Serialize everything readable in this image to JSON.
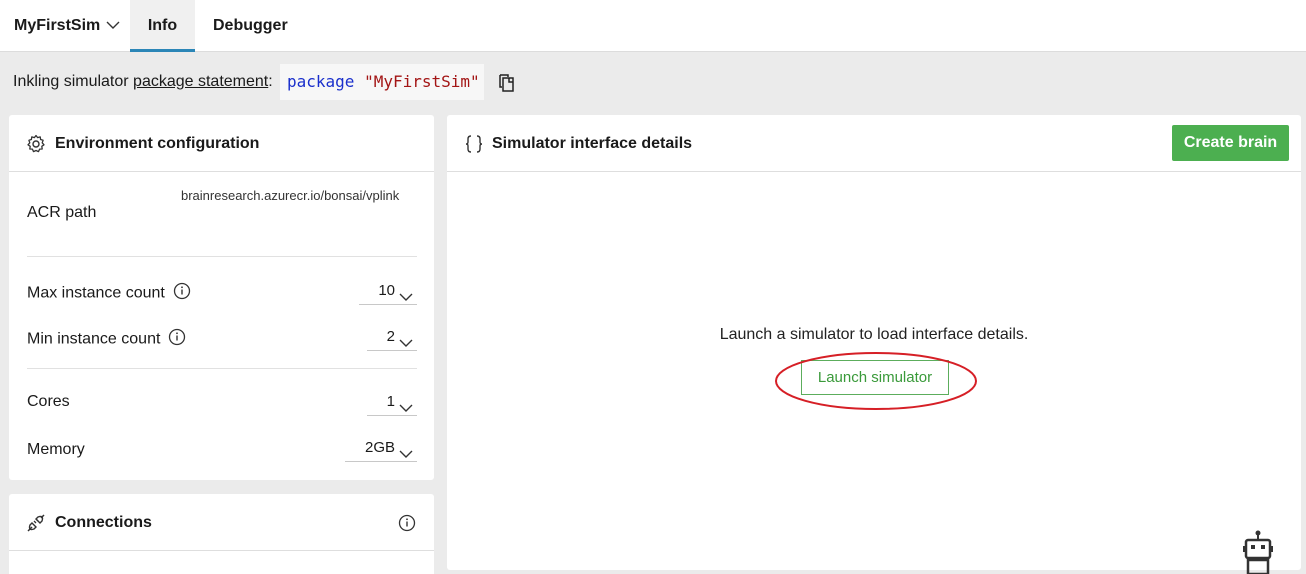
{
  "topbar": {
    "sim_name": "MyFirstSim",
    "tabs": [
      {
        "label": "Info",
        "active": true
      },
      {
        "label": "Debugger",
        "active": false
      }
    ]
  },
  "package_row": {
    "prefix": "Inkling simulator ",
    "link_text": "package statement",
    "suffix": ":",
    "code_keyword": "package",
    "code_string": "\"MyFirstSim\"",
    "copy_icon": "copy-icon"
  },
  "env_config": {
    "title": "Environment configuration",
    "icon": "gear-icon",
    "acr_label": "ACR path",
    "acr_value": "brainresearch.azurecr.io/bonsai/vplink",
    "max_instance_label": "Max instance count",
    "max_instance_value": "10",
    "min_instance_label": "Min instance count",
    "min_instance_value": "2",
    "cores_label": "Cores",
    "cores_value": "1",
    "memory_label": "Memory",
    "memory_value": "2GB"
  },
  "connections": {
    "title": "Connections",
    "icon": "plug-icon"
  },
  "sim_interface": {
    "title": "Simulator interface details",
    "icon": "braces-icon",
    "create_brain_label": "Create brain",
    "empty_message": "Launch a simulator to load interface details.",
    "launch_label": "Launch simulator"
  },
  "colors": {
    "accent_tab": "#2b86b7",
    "create_brain_bg": "#4caf50",
    "launch_border": "#5cad5c",
    "annotation_red": "#d61f26",
    "code_keyword": "#1a2fcc",
    "code_string": "#a31515"
  }
}
